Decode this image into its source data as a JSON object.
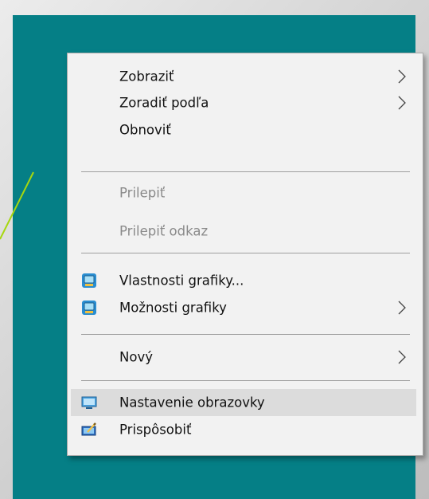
{
  "context_menu": {
    "items": [
      {
        "label": "Zobraziť",
        "submenu": true,
        "enabled": true
      },
      {
        "label": "Zoradiť podľa",
        "submenu": true,
        "enabled": true
      },
      {
        "label": "Obnoviť",
        "submenu": false,
        "enabled": true
      },
      {
        "label": "Prilepiť",
        "submenu": false,
        "enabled": false
      },
      {
        "label": "Prilepiť odkaz",
        "submenu": false,
        "enabled": false
      },
      {
        "label": "Vlastnosti grafiky...",
        "submenu": false,
        "enabled": true,
        "icon": "intel-graphics-icon"
      },
      {
        "label": "Možnosti grafiky",
        "submenu": true,
        "enabled": true,
        "icon": "intel-graphics-icon"
      },
      {
        "label": "Nový",
        "submenu": true,
        "enabled": true
      },
      {
        "label": "Nastavenie obrazovky",
        "submenu": false,
        "enabled": true,
        "icon": "display-settings-icon",
        "highlighted": true
      },
      {
        "label": "Prispôsobiť",
        "submenu": false,
        "enabled": true,
        "icon": "personalize-icon"
      }
    ]
  },
  "colors": {
    "desktop": "#057f86",
    "menu_bg": "#f2f2f2",
    "highlight": "#dcdcdc",
    "pointer_line": "#a6d70e"
  }
}
